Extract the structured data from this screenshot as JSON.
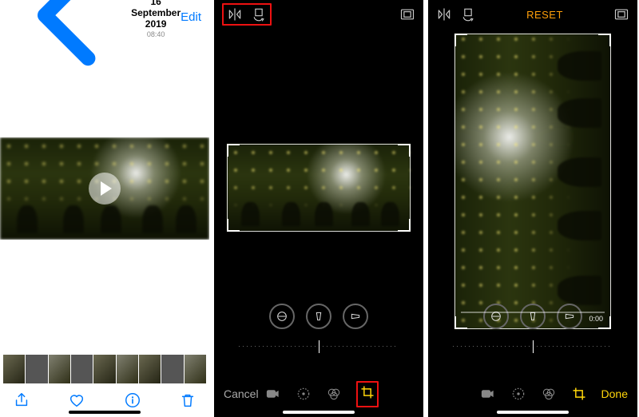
{
  "screen1": {
    "date": "16 September 2019",
    "time": "08:40",
    "edit_label": "Edit"
  },
  "editor": {
    "reset_label": "RESET",
    "cancel_label": "Cancel",
    "done_label": "Done",
    "video_time": "0:00"
  },
  "icons": {
    "back": "back-chevron-icon",
    "share": "share-icon",
    "favorite": "heart-icon",
    "info": "info-icon",
    "trash": "trash-icon",
    "flip": "flip-horizontal-icon",
    "rotate": "rotate-icon",
    "aspect": "aspect-ratio-icon",
    "straighten": "straighten-icon",
    "horizontal-persp": "horizontal-perspective-icon",
    "vertical-persp": "vertical-perspective-icon",
    "mode-video": "video-mode-icon",
    "mode-adjust": "adjust-mode-icon",
    "mode-filters": "filters-mode-icon",
    "mode-crop": "crop-mode-icon"
  },
  "colors": {
    "ios_blue": "#007aff",
    "ios_yellow": "#ffd60a",
    "ios_orange": "#ff9f0a",
    "highlight_red": "#e11"
  }
}
